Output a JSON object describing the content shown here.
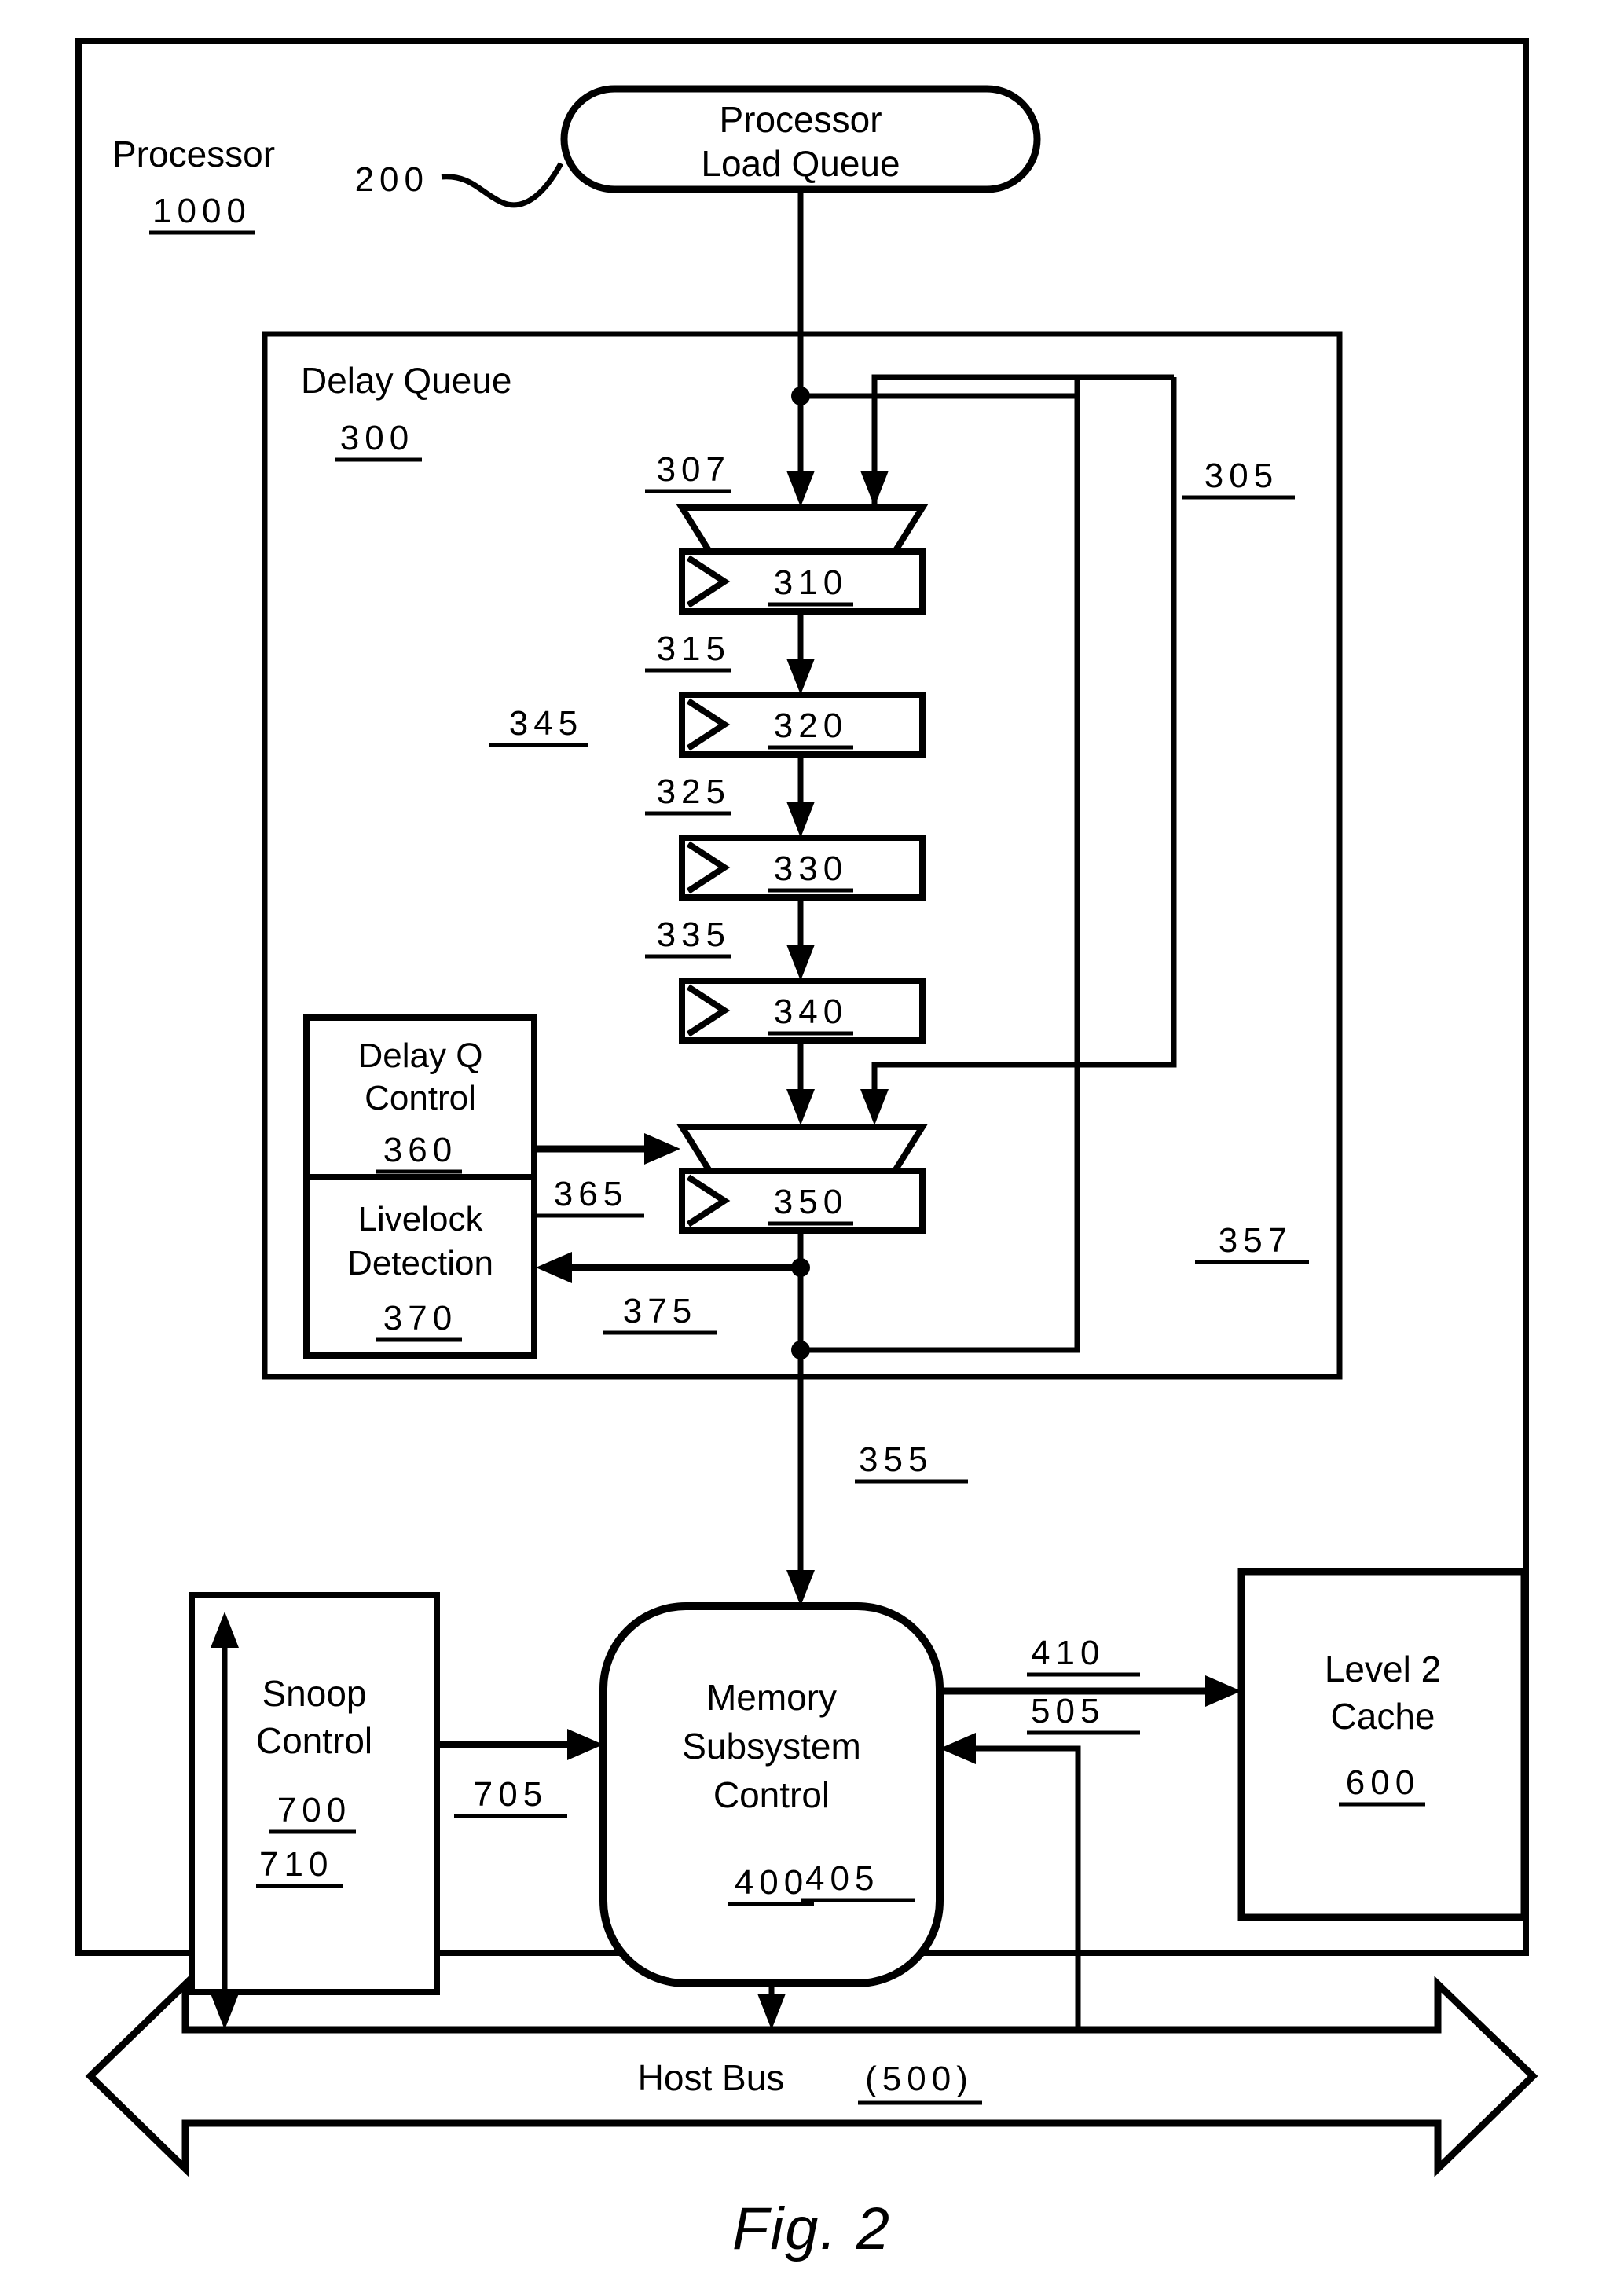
{
  "figure": {
    "caption": "Fig. 2",
    "title": "Processor memory subsystem block diagram"
  },
  "processor": {
    "label": "Processor",
    "ref": "1000"
  },
  "load_queue": {
    "line1": "Processor",
    "line2": "Load Queue",
    "ref": "200"
  },
  "delay_queue": {
    "label": "Delay Queue",
    "ref": "300",
    "bus_ref": "345",
    "mux_in_ref": "307",
    "feedback_ref": "305",
    "feedback_outer_ref": "357",
    "stages": [
      {
        "ref": "310",
        "out_ref": "315"
      },
      {
        "ref": "320",
        "out_ref": "325"
      },
      {
        "ref": "330",
        "out_ref": "335"
      },
      {
        "ref": "340",
        "out_ref": ""
      }
    ],
    "output_reg": {
      "ref": "350"
    },
    "output_ref": "355",
    "control": {
      "line1": "Delay Q",
      "line2": "Control",
      "ref": "360",
      "out_ref": "365"
    },
    "livelock": {
      "line1": "Livelock",
      "line2": "Detection",
      "ref": "370",
      "in_ref": "375"
    }
  },
  "snoop_control": {
    "line1": "Snoop",
    "line2": "Control",
    "ref": "700",
    "out_ref": "705",
    "bus_ref": "710"
  },
  "memory_subsystem": {
    "line1": "Memory",
    "line2": "Subsystem",
    "line3": "Control",
    "ref": "400",
    "to_l2_ref": "410",
    "from_bus_ref": "505",
    "to_bus_ref": "405"
  },
  "l2_cache": {
    "line1": "Level 2",
    "line2": "Cache",
    "ref": "600"
  },
  "host_bus": {
    "label": "Host Bus",
    "ref": "(500)"
  },
  "colors": {
    "stroke": "#000000",
    "background": "#ffffff"
  }
}
